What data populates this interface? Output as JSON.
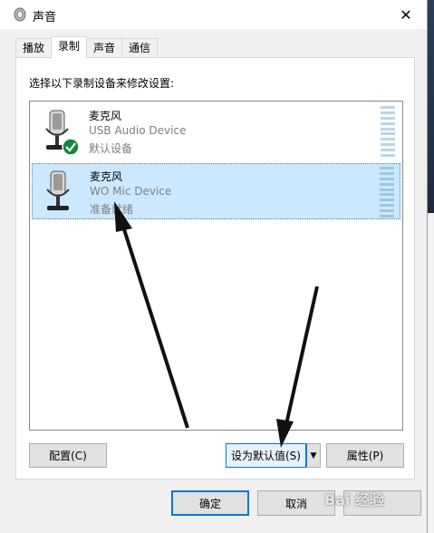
{
  "window": {
    "title": "声音",
    "close_glyph": "✕"
  },
  "tabs": [
    {
      "label": "播放",
      "active": false
    },
    {
      "label": "录制",
      "active": true
    },
    {
      "label": "声音",
      "active": false
    },
    {
      "label": "通信",
      "active": false
    }
  ],
  "instruction": "选择以下录制设备来修改设置:",
  "devices": [
    {
      "name": "麦克风",
      "description": "USB Audio Device",
      "status": "默认设备",
      "icon": "microphone-icon",
      "badge": "default-check-icon",
      "selected": false
    },
    {
      "name": "麦克风",
      "description": "WO Mic Device",
      "status": "准备就绪",
      "icon": "microphone-icon",
      "selected": true
    }
  ],
  "buttons": {
    "configure": "配置(C)",
    "set_default": "设为默认值(S)",
    "set_default_arrow": "▼",
    "properties": "属性(P)",
    "ok": "确定",
    "cancel": "取消"
  },
  "watermark": "Bai 经验",
  "colors": {
    "selection": "#cce8ff",
    "accent": "#0078d7",
    "check_green": "#10893e"
  }
}
